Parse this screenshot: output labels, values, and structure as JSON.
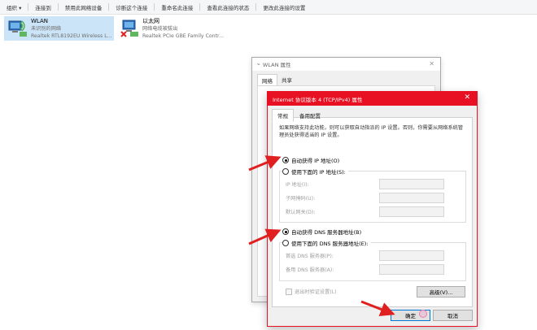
{
  "toolbar": {
    "items": [
      "组织 ▾",
      "连接到",
      "禁用此网络设备",
      "诊断这个连接",
      "重命名此连接",
      "查看此连接的状态",
      "更改此连接的设置"
    ]
  },
  "adapters": [
    {
      "name": "WLAN",
      "status": "未识别的网络",
      "device": "Realtek RTL8192EU Wireless L..."
    },
    {
      "name": "以太网",
      "status": "网络电缆被拔出",
      "device": "Realtek PCIe GBE Family Contr..."
    }
  ],
  "wlan_dialog": {
    "title": "WLAN 属性",
    "tabs": [
      "网络",
      "共享"
    ]
  },
  "ipv4_dialog": {
    "title": "Internet 协议版本 4 (TCP/IPv4) 属性",
    "tabs": [
      "常规",
      "备用配置"
    ],
    "description": "如果网络支持此功能，则可以获取自动指派的 IP 设置。否则，你需要从网络系统管理员处获得适当的 IP 设置。",
    "ip_auto": "自动获得 IP 地址(O)",
    "ip_manual": "使用下面的 IP 地址(S):",
    "ip_address_label": "IP 地址(I):",
    "subnet_label": "子网掩码(U):",
    "gateway_label": "默认网关(D):",
    "dns_auto": "自动获得 DNS 服务器地址(B)",
    "dns_manual": "使用下面的 DNS 服务器地址(E):",
    "preferred_dns_label": "首选 DNS 服务器(P):",
    "alternate_dns_label": "备用 DNS 服务器(A):",
    "validate_label": "退出时验证设置(L)",
    "advanced_button": "高级(V)...",
    "ok_button": "确定",
    "cancel_button": "取消"
  },
  "colors": {
    "title_bar": "#e81123",
    "annotation_arrow": "#e02020",
    "selection": "#cce4f7"
  }
}
